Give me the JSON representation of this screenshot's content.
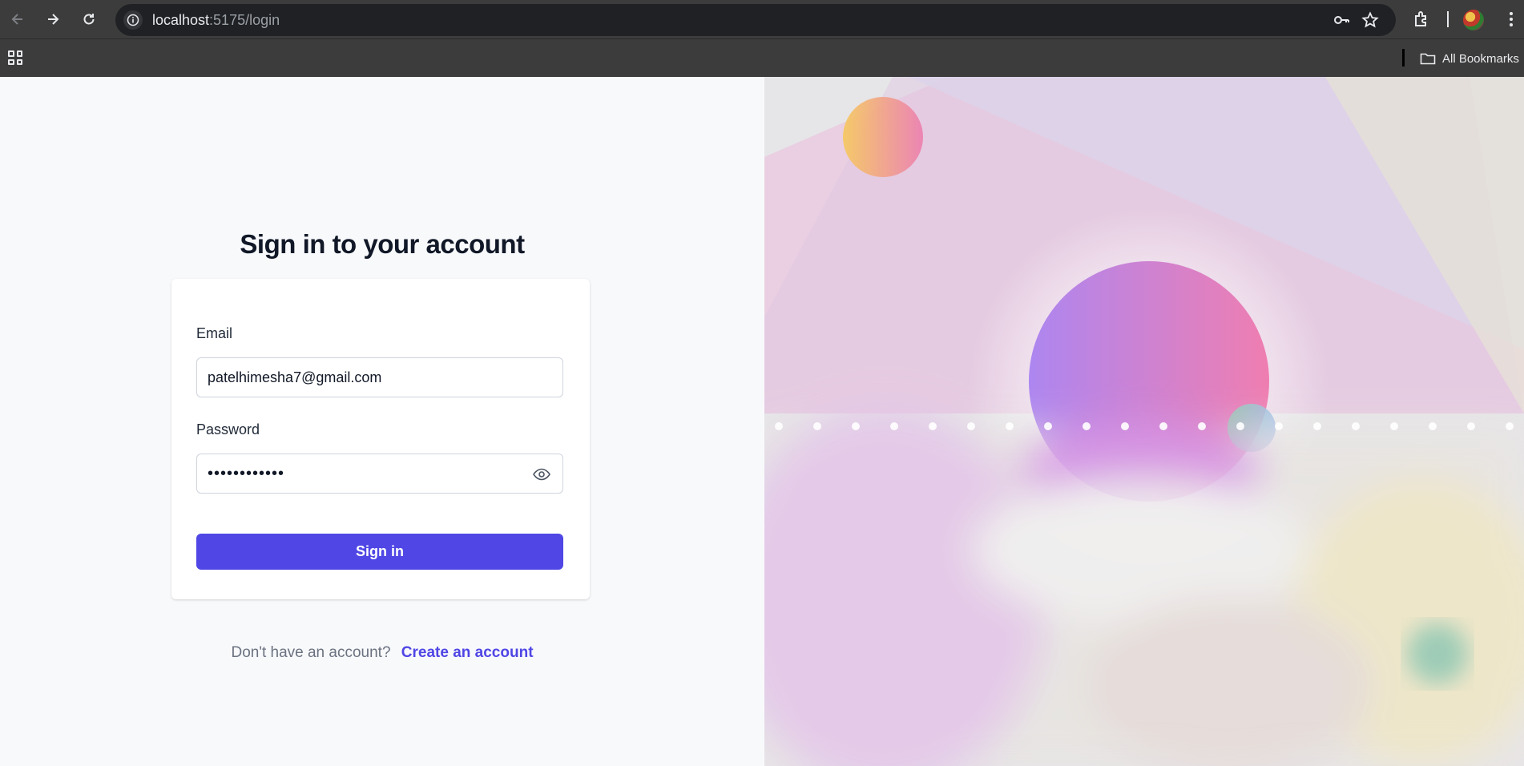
{
  "browser": {
    "url_host": "localhost",
    "url_rest": ":5175/login",
    "bookmarks_label": "All Bookmarks"
  },
  "login": {
    "title": "Sign in to your account",
    "email_label": "Email",
    "email_value": "patelhimesha7@gmail.com",
    "password_label": "Password",
    "password_value": "••••••••••••",
    "signin_label": "Sign in",
    "no_account_text": "Don't have an account?",
    "create_account_label": "Create an account"
  },
  "colors": {
    "accent": "#4f46e5",
    "heading": "#111827",
    "muted": "#6b7280"
  }
}
